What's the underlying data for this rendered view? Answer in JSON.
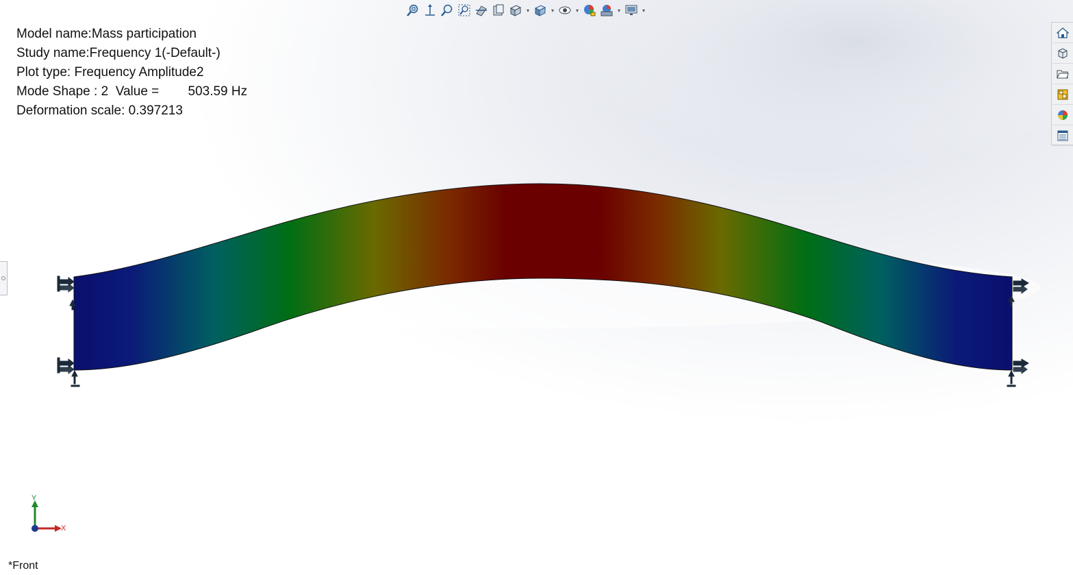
{
  "info": {
    "model_name": "Model name:Mass participation",
    "study_name": "Study name:Frequency 1(-Default-)",
    "plot_type": "Plot type: Frequency Amplitude2",
    "mode_shape": "Mode Shape : 2  Value =        503.59 Hz",
    "deformation_scale": "Deformation scale: 0.397213"
  },
  "view": {
    "label": "*Front"
  },
  "triad": {
    "x_label": "X",
    "y_label": "Y"
  },
  "toolbar": {
    "icons": [
      "zoom-to-fit-icon",
      "zoom-to-area-icon",
      "zoom-icon",
      "zoom-selection-icon",
      "section-view-icon",
      "dynamic-annotation-icon",
      "view-orientation-icon",
      "display-style-icon",
      "hide-show-icon",
      "appearance-icon",
      "scene-icon",
      "view-settings-icon"
    ]
  },
  "right_panel": {
    "icons": [
      "home-icon",
      "resources-icon",
      "folder-icon",
      "view-palette-icon",
      "appearances-icon",
      "custom-properties-icon"
    ]
  },
  "colors": {
    "fringe_low": "#0a0f6e",
    "fringe_mid_low": "#006060",
    "fringe_mid": "#006e14",
    "fringe_mid_high": "#6a6a00",
    "fringe_high": "#6a0000"
  }
}
